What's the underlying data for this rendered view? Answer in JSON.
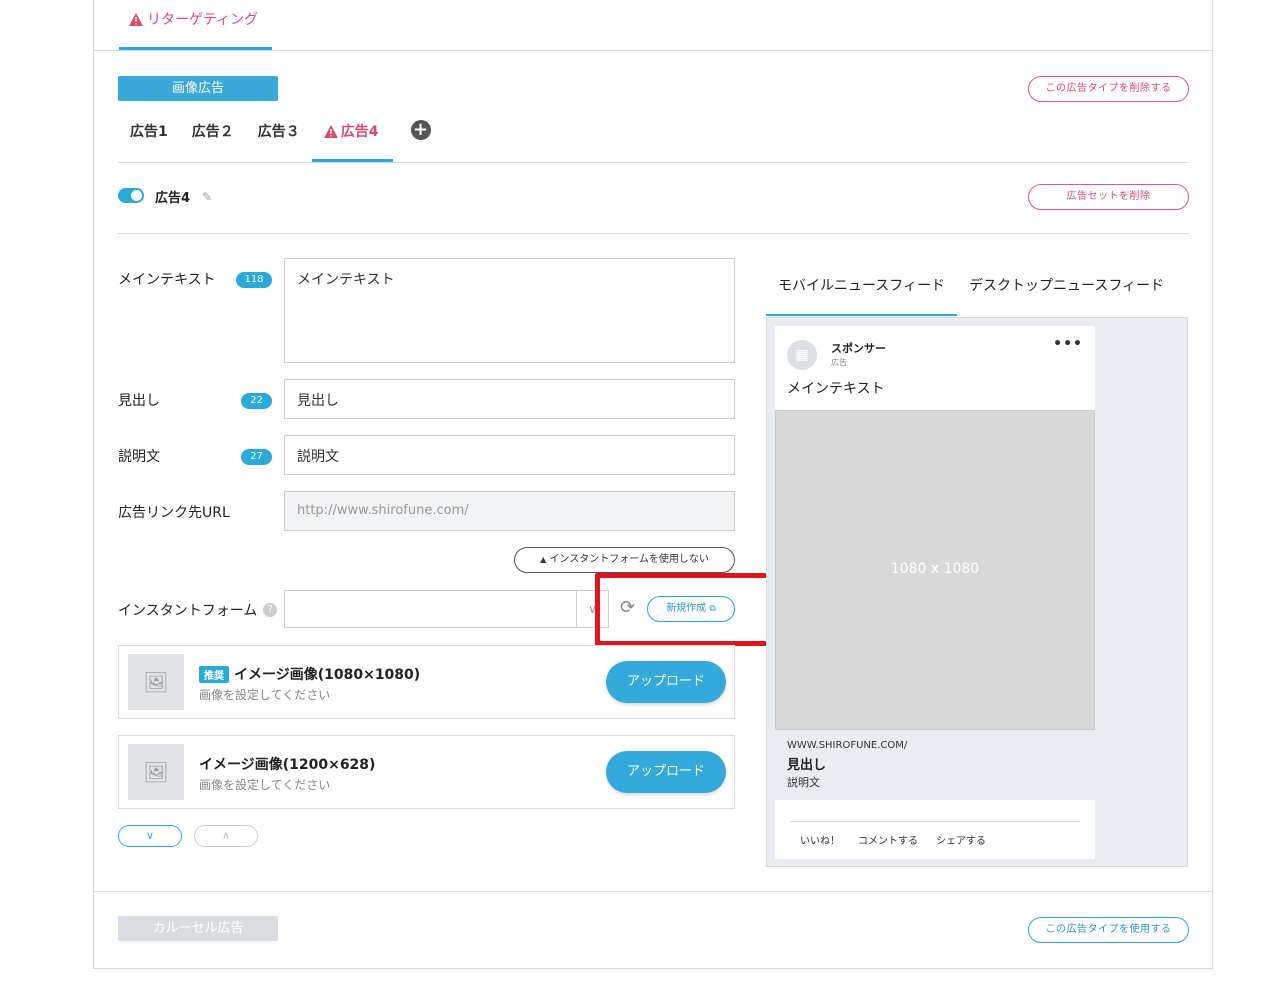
{
  "retargeting_tab": {
    "label": "リターゲティング"
  },
  "image_ad": {
    "type_label": "画像広告",
    "delete_type_label": "この広告タイプを削除する",
    "tabs": [
      {
        "label": "広告1"
      },
      {
        "label": "広告２"
      },
      {
        "label": "広告３"
      },
      {
        "label": "広告4"
      }
    ],
    "active_tab": 3,
    "ad_name": "広告4",
    "ad_enabled": true,
    "delete_set_label": "広告セットを削除"
  },
  "form": {
    "main_text": {
      "label": "メインテキスト",
      "count": "118",
      "value": "メインテキスト"
    },
    "headline": {
      "label": "見出し",
      "count": "22",
      "value": "見出し"
    },
    "description": {
      "label": "説明文",
      "count": "27",
      "value": "説明文"
    },
    "link_url": {
      "label": "広告リンク先URL",
      "placeholder": "http://www.shirofune.com/"
    },
    "instant_form_toggle": "インスタントフォームを使用しない",
    "instant_form": {
      "label": "インスタントフォーム",
      "value": "",
      "new_label": "新規作成"
    }
  },
  "images": [
    {
      "badge": "推奨",
      "title": "イメージ画像(1080×1080)",
      "subtitle": "画像を設定してください",
      "button": "アップロード"
    },
    {
      "badge": "",
      "title": "イメージ画像(1200×628)",
      "subtitle": "画像を設定してください",
      "button": "アップロード"
    }
  ],
  "preview": {
    "tabs": [
      {
        "label": "モバイルニュースフィード"
      },
      {
        "label": "デスクトップニュースフィード"
      }
    ],
    "active_tab": 0,
    "sponsor": "スポンサー",
    "sponsor_sub": "広告",
    "more": "•••",
    "main_text": "メインテキスト",
    "image_size": "1080 x 1080",
    "url": "WWW.SHIROFUNE.COM/",
    "headline": "見出し",
    "description": "説明文",
    "actions": [
      "いいね！",
      "コメントする",
      "シェアする"
    ]
  },
  "carousel_ad": {
    "type_label": "カルーセル広告",
    "use_type_label": "この広告タイプを使用する"
  },
  "colors": {
    "accent": "#2aaad8",
    "warning": "#e0486b",
    "highlight": "#e0141b"
  }
}
